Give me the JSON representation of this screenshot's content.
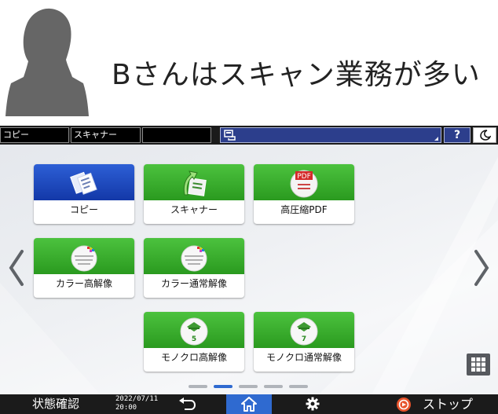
{
  "caption": "Bさんはスキャン業務が多い",
  "topbar": {
    "tabs": [
      "コピー",
      "スキャナー",
      ""
    ],
    "help_label": "?"
  },
  "apps": [
    {
      "label": "コピー",
      "icon": "copy-icon",
      "color": "blue"
    },
    {
      "label": "スキャナー",
      "icon": "scanner-icon",
      "color": "green"
    },
    {
      "label": "高圧縮PDF",
      "icon": "pdf-icon",
      "color": "green",
      "icon_text": "PDF"
    },
    {
      "label": "カラー高解像",
      "icon": "color-disc-icon",
      "color": "green"
    },
    {
      "label": "カラー通常解像",
      "icon": "color-disc-icon",
      "color": "green"
    },
    {
      "label": "モノクロ高解像",
      "icon": "mono-disc-icon",
      "color": "green",
      "icon_text": "5"
    },
    {
      "label": "モノクロ通常解像",
      "icon": "mono-disc-icon",
      "color": "green",
      "icon_text": "7"
    }
  ],
  "pagination": {
    "total": 5,
    "active": 2
  },
  "bottombar": {
    "status_check": "状態確認",
    "date": "2022/07/11",
    "time": "20:00",
    "stop": "ストップ"
  },
  "colors": {
    "green": "#2a9a1f",
    "blue": "#1338a8",
    "accent": "#2f6ad0",
    "bar": "#1b1b1b"
  }
}
